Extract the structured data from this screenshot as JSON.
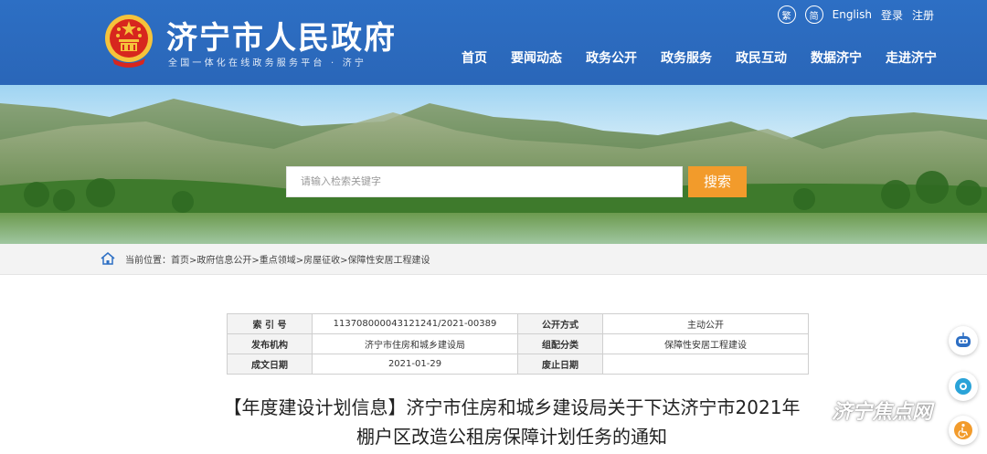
{
  "header": {
    "site_title": "济宁市人民政府",
    "site_subtitle": "全国一体化在线政务服务平台 · 济宁",
    "top_links": {
      "traditional": "繁",
      "simplified": "简",
      "english": "English",
      "login": "登录",
      "register": "注册"
    },
    "nav": [
      "首页",
      "要闻动态",
      "政务公开",
      "政务服务",
      "政民互动",
      "数据济宁",
      "走进济宁"
    ]
  },
  "search": {
    "placeholder": "请输入检索关键字",
    "button_label": "搜索"
  },
  "breadcrumb": {
    "prefix": "当前位置：",
    "items": [
      "首页",
      "政府信息公开",
      "重点领域",
      "房屋征收",
      "保障性安居工程建设"
    ],
    "separator": ">"
  },
  "meta_table": {
    "rows": [
      {
        "k1": "索 引 号",
        "v1": "113708000043121241/2021-00389",
        "k2": "公开方式",
        "v2": "主动公开"
      },
      {
        "k1": "发布机构",
        "v1": "济宁市住房和城乡建设局",
        "k2": "组配分类",
        "v2": "保障性安居工程建设"
      },
      {
        "k1": "成文日期",
        "v1": "2021-01-29",
        "k2": "废止日期",
        "v2": ""
      }
    ]
  },
  "document": {
    "title_line1": "【年度建设计划信息】济宁市住房和城乡建设局关于下达济宁市2021年",
    "title_line2": "棚户区改造公租房保障计划任务的通知"
  },
  "watermark": "济宁焦点网",
  "colors": {
    "header_blue": "#2d6fc4",
    "search_orange": "#f29b2b",
    "emblem_red": "#d7261e",
    "emblem_gold": "#f5c33b"
  }
}
